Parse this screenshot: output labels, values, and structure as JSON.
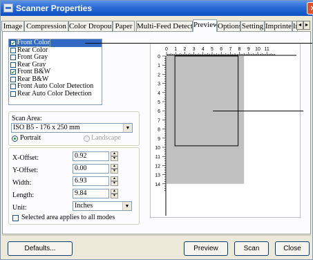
{
  "window": {
    "title": "Scanner Properties",
    "close_glyph": "×"
  },
  "tabs": [
    {
      "label": "Image",
      "active": false
    },
    {
      "label": "Compression",
      "active": false
    },
    {
      "label": "Color Dropout",
      "active": false
    },
    {
      "label": "Paper",
      "active": false
    },
    {
      "label": "Multi-Feed Detection",
      "active": false
    },
    {
      "label": "Preview",
      "active": true
    },
    {
      "label": "Options",
      "active": false
    },
    {
      "label": "Setting",
      "active": false
    },
    {
      "label": "Imprinter",
      "active": false
    },
    {
      "label": "In",
      "active": false
    }
  ],
  "tab_scroll": {
    "left_glyph": "◄",
    "right_glyph": "►"
  },
  "image_modes": [
    {
      "label": "Front Color",
      "checked": true,
      "selected": true
    },
    {
      "label": "Rear Color",
      "checked": false,
      "selected": false
    },
    {
      "label": "Front Gray",
      "checked": false,
      "selected": false
    },
    {
      "label": "Rear Gray",
      "checked": false,
      "selected": false
    },
    {
      "label": "Front B&W",
      "checked": true,
      "selected": false
    },
    {
      "label": "Rear B&W",
      "checked": false,
      "selected": false
    },
    {
      "label": "Front Auto Color Detection",
      "checked": false,
      "selected": false
    },
    {
      "label": "Rear Auto Color Detection",
      "checked": false,
      "selected": false
    }
  ],
  "scan_area": {
    "label": "Scan Area:",
    "value": "ISO B5 - 176 x 250 mm",
    "orientation": {
      "portrait": "Portrait",
      "landscape": "Landscape",
      "selected": "portrait"
    }
  },
  "offsets": {
    "x_offset": {
      "label": "X-Offset:",
      "value": "0.92"
    },
    "y_offset": {
      "label": "Y-Offset:",
      "value": "0.00"
    },
    "width": {
      "label": "Width:",
      "value": "6.93"
    },
    "length": {
      "label": "Length:",
      "value": "9.84"
    },
    "unit": {
      "label": "Unit:",
      "value": "Inches"
    },
    "apply_all": {
      "label": "Selected area applies to all modes",
      "checked": false
    }
  },
  "preview": {
    "ruler_h": [
      "0",
      "1",
      "2",
      "3",
      "4",
      "5",
      "6",
      "7",
      "8",
      "9",
      "10",
      "11"
    ],
    "ruler_v": [
      "0",
      "1",
      "2",
      "3",
      "4",
      "5",
      "6",
      "7",
      "8",
      "9",
      "10",
      "11",
      "12",
      "13",
      "14"
    ],
    "page_width_in": 8.5,
    "page_length_in": 14,
    "selection": {
      "x_in": 0.92,
      "y_in": 0.0,
      "w_in": 6.93,
      "h_in": 9.84
    }
  },
  "buttons": {
    "defaults": "Defaults...",
    "preview": "Preview",
    "scan": "Scan",
    "close": "Close"
  },
  "colors": {
    "title_bar": "#0c4fc4",
    "selection_highlight": "#316ac5",
    "preview_page": "#c0c0c0",
    "dialog_bg": "#ece9d8"
  }
}
